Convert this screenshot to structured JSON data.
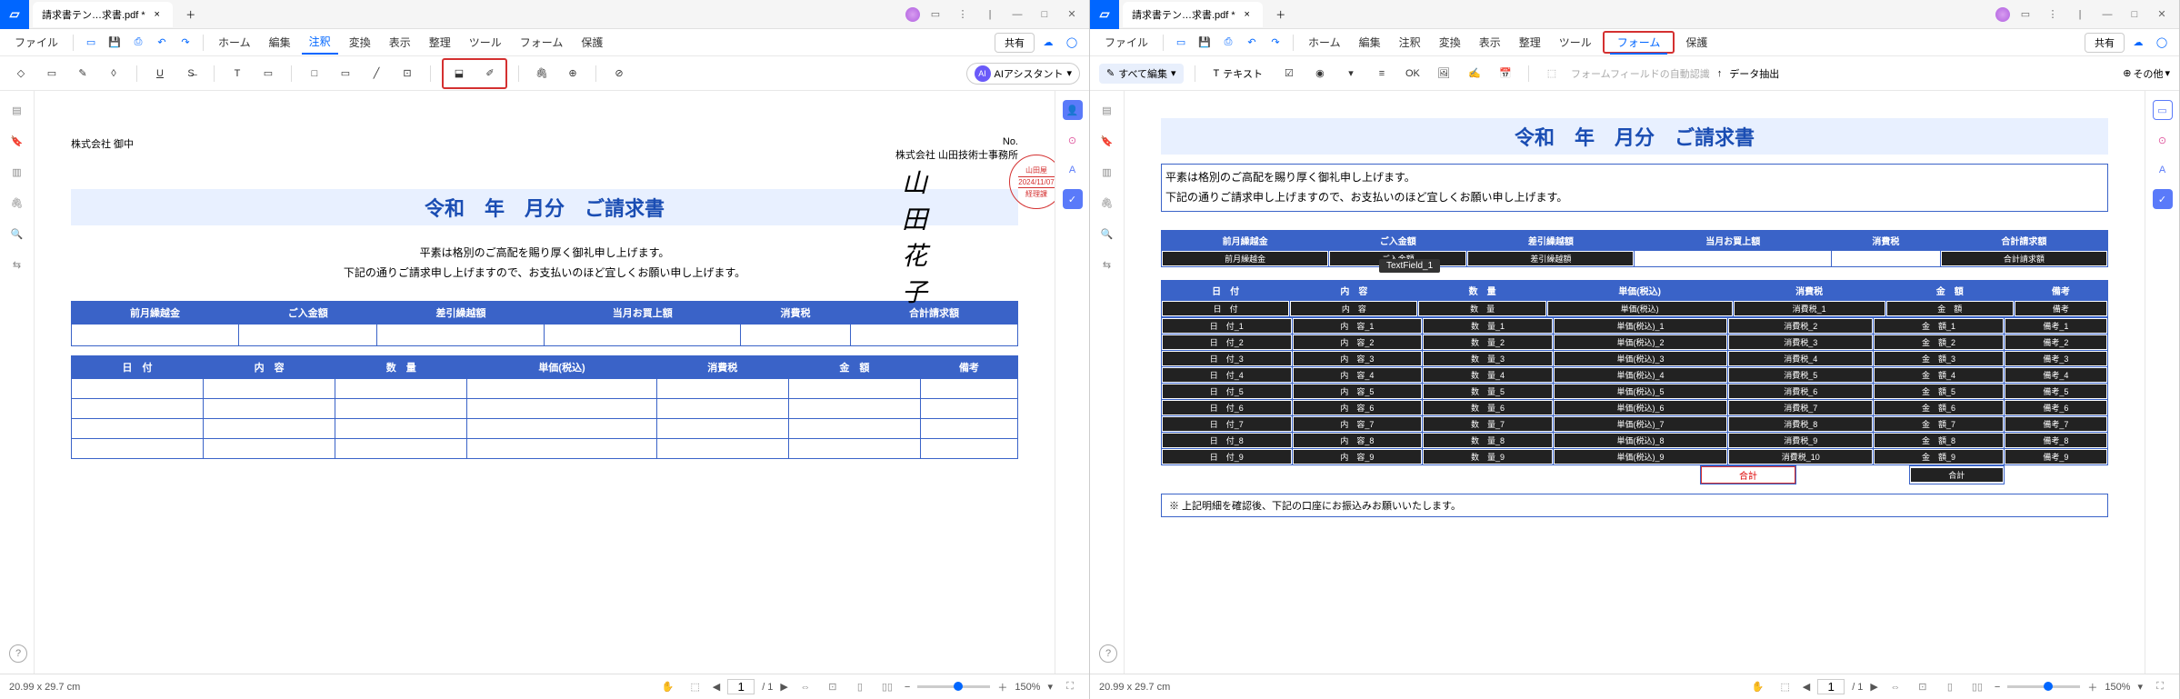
{
  "pane1": {
    "tab_title": "請求書テン…求書.pdf *",
    "file_menu": "ファイル",
    "menus": [
      "ホーム",
      "編集",
      "注釈",
      "変換",
      "表示",
      "整理",
      "ツール",
      "フォーム",
      "保護"
    ],
    "active_menu": "注釈",
    "share": "共有",
    "ai_label": "AIアシスタント",
    "doc": {
      "addressee": "株式会社 御中",
      "no_label": "No.",
      "sender": "株式会社 山田技術士事務所",
      "signature": "山田 花子",
      "stamp_top": "山田屋",
      "stamp_date": "2024/11/07",
      "stamp_bottom": "経理課",
      "title": "令和　年　月分　ご請求書",
      "body1": "平素は格別のご高配を賜り厚く御礼申し上げます。",
      "body2": "下記の通りご請求申し上げますので、お支払いのほど宜しくお願い申し上げます。",
      "sum_headers": [
        "前月繰越金",
        "ご入金額",
        "差引繰越額",
        "当月お買上額",
        "消費税",
        "合計請求額"
      ],
      "det_headers": [
        "日　付",
        "内　容",
        "数　量",
        "単価(税込)",
        "消費税",
        "金　額",
        "備考"
      ]
    },
    "status_size": "20.99 x 29.7 cm",
    "page_cur": "1",
    "page_total": "/ 1",
    "zoom": "150%"
  },
  "pane2": {
    "tab_title": "請求書テン…求書.pdf *",
    "file_menu": "ファイル",
    "menus": [
      "ホーム",
      "編集",
      "注釈",
      "変換",
      "表示",
      "整理",
      "ツール",
      "フォーム",
      "保護"
    ],
    "active_menu": "フォーム",
    "share": "共有",
    "edit_all": "すべて編集",
    "text_tool": "テキスト",
    "auto_recog": "フォームフィールドの自動認識",
    "data_extract": "データ抽出",
    "more": "その他",
    "doc": {
      "title": "令和　年　月分　ご請求書",
      "body1": "平素は格別のご高配を賜り厚く御礼申し上げます。",
      "body2": "下記の通りご請求申し上げますので、お支払いのほど宜しくお願い申し上げます。",
      "sum_headers": [
        "前月繰越金",
        "ご入金額",
        "差引繰越額",
        "当月お買上額",
        "消費税",
        "合計請求額"
      ],
      "sum_fields": [
        "前月繰越金",
        "ご入金額",
        "差引繰越額",
        "",
        "",
        ""
      ],
      "sum_field_right": "合計請求額",
      "tooltip": "TextField_1",
      "det_headers": [
        "日　付",
        "内　容",
        "数　量",
        "単価(税込)",
        "消費税",
        "金　額",
        "備考"
      ],
      "row0": [
        "日　付",
        "内　容",
        "数　量",
        "単価(税込)",
        "消費税_1",
        "金　額",
        "備考"
      ],
      "rows": [
        [
          "日　付_1",
          "内　容_1",
          "数　量_1",
          "単価(税込)_1",
          "消費税_2",
          "金　額_1",
          "備考_1"
        ],
        [
          "日　付_2",
          "内　容_2",
          "数　量_2",
          "単価(税込)_2",
          "消費税_3",
          "金　額_2",
          "備考_2"
        ],
        [
          "日　付_3",
          "内　容_3",
          "数　量_3",
          "単価(税込)_3",
          "消費税_4",
          "金　額_3",
          "備考_3"
        ],
        [
          "日　付_4",
          "内　容_4",
          "数　量_4",
          "単価(税込)_4",
          "消費税_5",
          "金　額_4",
          "備考_4"
        ],
        [
          "日　付_5",
          "内　容_5",
          "数　量_5",
          "単価(税込)_5",
          "消費税_6",
          "金　額_5",
          "備考_5"
        ],
        [
          "日　付_6",
          "内　容_6",
          "数　量_6",
          "単価(税込)_6",
          "消費税_7",
          "金　額_6",
          "備考_6"
        ],
        [
          "日　付_7",
          "内　容_7",
          "数　量_7",
          "単価(税込)_7",
          "消費税_8",
          "金　額_7",
          "備考_7"
        ],
        [
          "日　付_8",
          "内　容_8",
          "数　量_8",
          "単価(税込)_8",
          "消費税_9",
          "金　額_8",
          "備考_8"
        ],
        [
          "日　付_9",
          "内　容_9",
          "数　量_9",
          "単価(税込)_9",
          "消費税_10",
          "金　額_9",
          "備考_9"
        ]
      ],
      "total_label": "合計",
      "total_field": "合計",
      "note": "※ 上記明細を確認後、下記の口座にお振込みお願いいたします。"
    },
    "status_size": "20.99 x 29.7 cm",
    "page_cur": "1",
    "page_total": "/ 1",
    "zoom": "150%"
  }
}
